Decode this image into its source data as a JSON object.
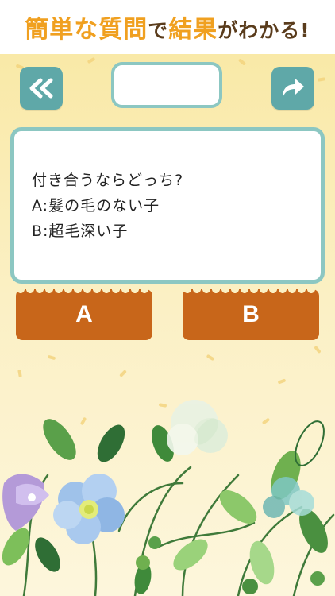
{
  "banner": {
    "parts": [
      {
        "text": "簡単な",
        "kind": "hl"
      },
      {
        "text": "質問",
        "kind": "hl"
      },
      {
        "text": "で",
        "kind": "dk"
      },
      {
        "text": "結果",
        "kind": "hl"
      },
      {
        "text": "がわかる!",
        "kind": "dk"
      }
    ]
  },
  "toolbar": {
    "back_icon": "double-chevron-left-icon",
    "share_icon": "share-arrow-icon",
    "title": ""
  },
  "question": {
    "line1": "付き合うならどっち?",
    "line2": "A:髪の毛のない子",
    "line3": "B:超毛深い子"
  },
  "choices": {
    "a_label": "A",
    "b_label": "B"
  },
  "colors": {
    "accent_teal": "#5fa8a8",
    "card_border": "#8cc7c2",
    "choice_button": "#c8661a",
    "banner_highlight": "#f0a020",
    "banner_dark": "#5a3c1c",
    "background": "#f9e9a7"
  }
}
